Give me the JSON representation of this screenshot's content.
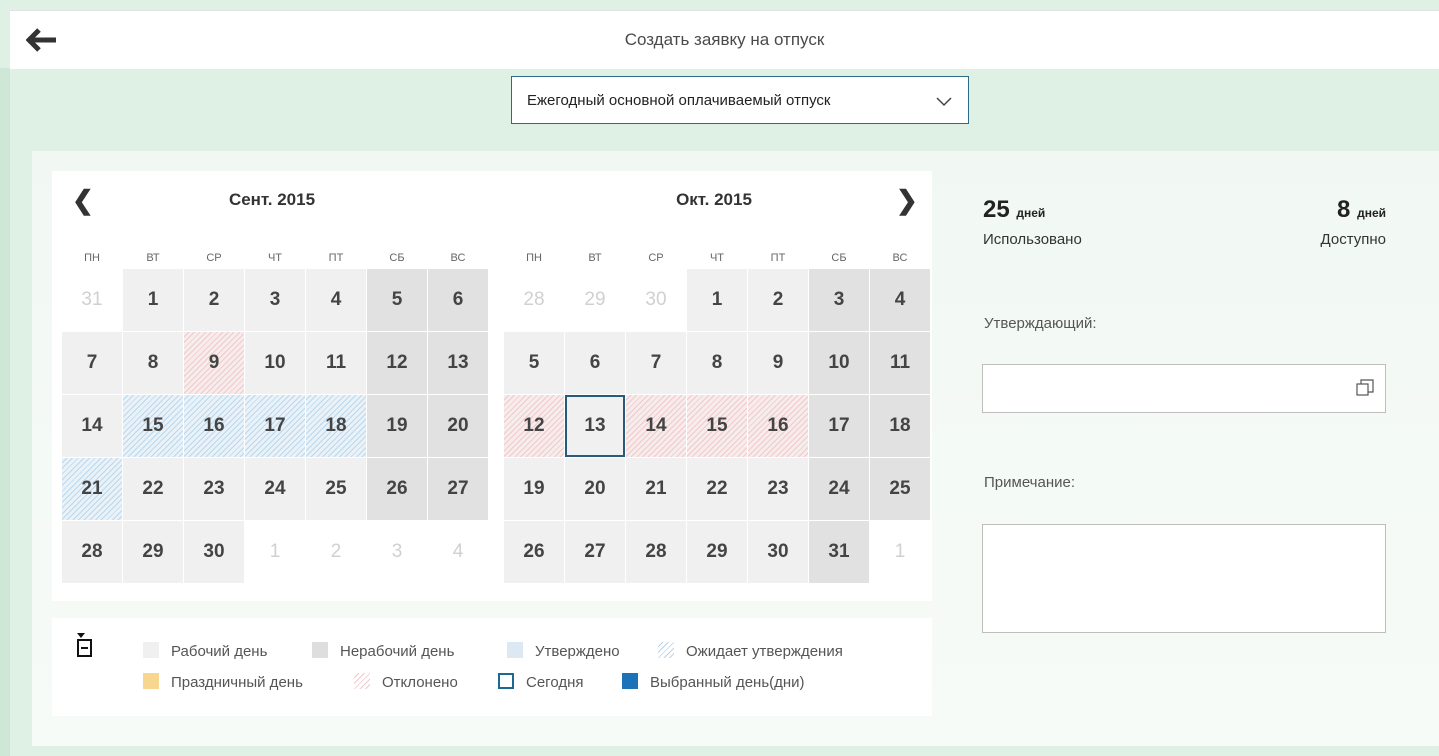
{
  "header": {
    "title": "Создать заявку на отпуск"
  },
  "leave_type": {
    "selected": "Ежегодный основной оплачиваемый отпуск"
  },
  "calendar": {
    "weekdays": [
      "ПН",
      "ВТ",
      "СР",
      "ЧТ",
      "ПТ",
      "СБ",
      "ВС"
    ],
    "months": [
      {
        "title": "Сент. 2015",
        "days": [
          {
            "d": "31",
            "s": "o"
          },
          {
            "d": "1",
            "s": "w"
          },
          {
            "d": "2",
            "s": "w"
          },
          {
            "d": "3",
            "s": "w"
          },
          {
            "d": "4",
            "s": "w"
          },
          {
            "d": "5",
            "s": "n"
          },
          {
            "d": "6",
            "s": "n"
          },
          {
            "d": "7",
            "s": "w"
          },
          {
            "d": "8",
            "s": "w"
          },
          {
            "d": "9",
            "s": "r"
          },
          {
            "d": "10",
            "s": "w"
          },
          {
            "d": "11",
            "s": "w"
          },
          {
            "d": "12",
            "s": "n"
          },
          {
            "d": "13",
            "s": "n"
          },
          {
            "d": "14",
            "s": "w"
          },
          {
            "d": "15",
            "s": "a"
          },
          {
            "d": "16",
            "s": "a"
          },
          {
            "d": "17",
            "s": "a"
          },
          {
            "d": "18",
            "s": "a"
          },
          {
            "d": "19",
            "s": "n"
          },
          {
            "d": "20",
            "s": "n"
          },
          {
            "d": "21",
            "s": "a"
          },
          {
            "d": "22",
            "s": "w"
          },
          {
            "d": "23",
            "s": "w"
          },
          {
            "d": "24",
            "s": "w"
          },
          {
            "d": "25",
            "s": "w"
          },
          {
            "d": "26",
            "s": "n"
          },
          {
            "d": "27",
            "s": "n"
          },
          {
            "d": "28",
            "s": "w"
          },
          {
            "d": "29",
            "s": "w"
          },
          {
            "d": "30",
            "s": "w"
          },
          {
            "d": "1",
            "s": "o"
          },
          {
            "d": "2",
            "s": "o"
          },
          {
            "d": "3",
            "s": "o"
          },
          {
            "d": "4",
            "s": "o"
          }
        ]
      },
      {
        "title": "Окт. 2015",
        "days": [
          {
            "d": "28",
            "s": "o"
          },
          {
            "d": "29",
            "s": "o"
          },
          {
            "d": "30",
            "s": "o"
          },
          {
            "d": "1",
            "s": "w"
          },
          {
            "d": "2",
            "s": "w"
          },
          {
            "d": "3",
            "s": "n"
          },
          {
            "d": "4",
            "s": "n"
          },
          {
            "d": "5",
            "s": "w"
          },
          {
            "d": "6",
            "s": "w"
          },
          {
            "d": "7",
            "s": "w"
          },
          {
            "d": "8",
            "s": "w"
          },
          {
            "d": "9",
            "s": "w"
          },
          {
            "d": "10",
            "s": "n"
          },
          {
            "d": "11",
            "s": "n"
          },
          {
            "d": "12",
            "s": "r"
          },
          {
            "d": "13",
            "s": "t"
          },
          {
            "d": "14",
            "s": "r"
          },
          {
            "d": "15",
            "s": "r"
          },
          {
            "d": "16",
            "s": "r"
          },
          {
            "d": "17",
            "s": "n"
          },
          {
            "d": "18",
            "s": "n"
          },
          {
            "d": "19",
            "s": "w"
          },
          {
            "d": "20",
            "s": "w"
          },
          {
            "d": "21",
            "s": "w"
          },
          {
            "d": "22",
            "s": "w"
          },
          {
            "d": "23",
            "s": "w"
          },
          {
            "d": "24",
            "s": "n"
          },
          {
            "d": "25",
            "s": "n"
          },
          {
            "d": "26",
            "s": "w"
          },
          {
            "d": "27",
            "s": "w"
          },
          {
            "d": "28",
            "s": "w"
          },
          {
            "d": "29",
            "s": "w"
          },
          {
            "d": "30",
            "s": "w"
          },
          {
            "d": "31",
            "s": "n"
          },
          {
            "d": "1",
            "s": "o"
          }
        ]
      }
    ]
  },
  "legend": {
    "working": "Рабочий день",
    "nonworking": "Нерабочий день",
    "approved": "Утверждено",
    "pending": "Ожидает утверждения",
    "holiday": "Праздничный день",
    "rejected": "Отклонено",
    "today": "Сегодня",
    "selected": "Выбранный день(дни)"
  },
  "stats": {
    "used_value": "25",
    "used_unit": "дней",
    "used_label": "Использовано",
    "available_value": "8",
    "available_unit": "дней",
    "available_label": "Доступно"
  },
  "form": {
    "approver_label": "Утверждающий:",
    "approver_value": "",
    "note_label": "Примечание:",
    "note_value": ""
  },
  "colors": {
    "accent": "#2b6b87",
    "background": "#dff0e4",
    "approved": "#dce9f4",
    "rejected": "#f1c8cb",
    "holiday": "#f7d68f",
    "selected": "#1a72b8"
  }
}
